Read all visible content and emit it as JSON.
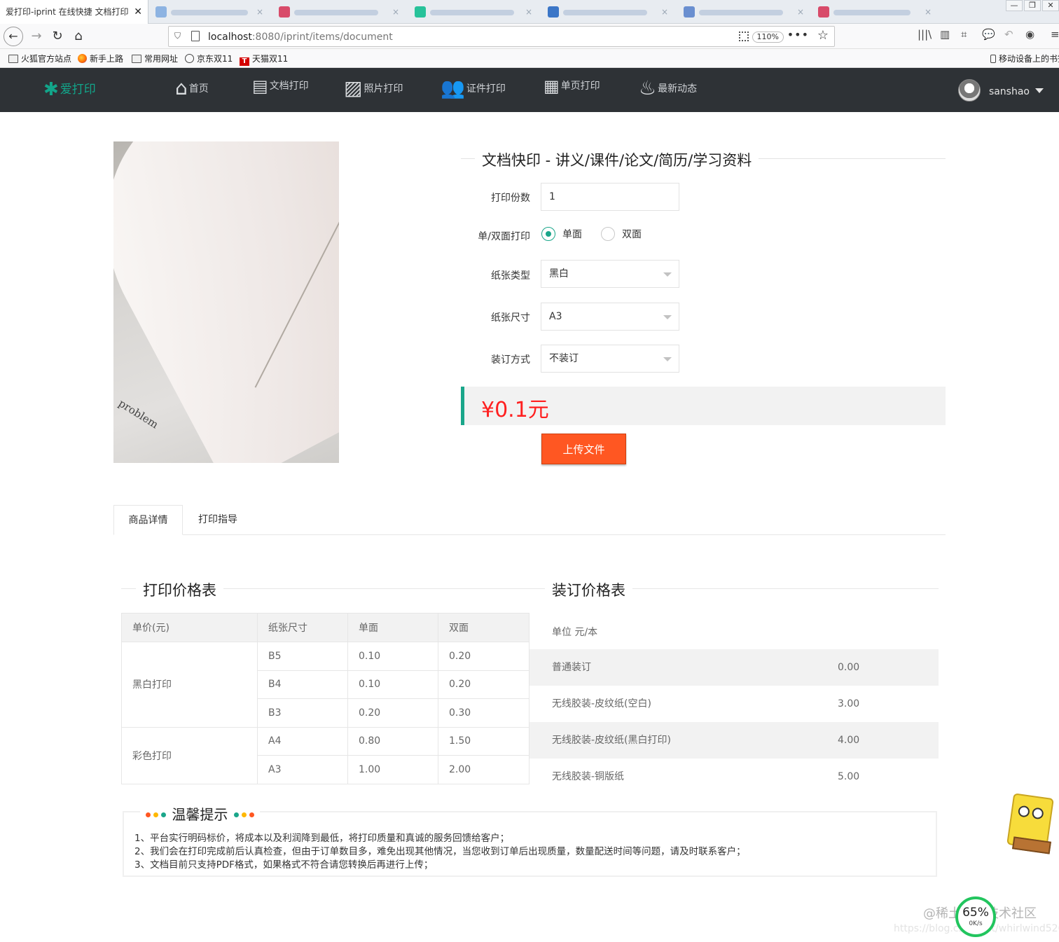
{
  "browser": {
    "active_tab_title": "爱打印-iprint 在线快捷 文档打印",
    "tab_close": "✕",
    "url_host": "localhost",
    "url_rest": ":8080/iprint/items/document",
    "zoom": "110%",
    "window_buttons": [
      "—",
      "❐",
      "✕"
    ],
    "bookmarks": [
      {
        "label": "火狐官方站点",
        "icon": "folder-icon"
      },
      {
        "label": "新手上路",
        "icon": "firefox-icon"
      },
      {
        "label": "常用网址",
        "icon": "folder-icon"
      },
      {
        "label": "京东双11",
        "icon": "globe-icon"
      },
      {
        "label": "天猫双11",
        "icon": "tmall-icon"
      }
    ],
    "mobile_bookmarks": "移动设备上的书签"
  },
  "site": {
    "logo_text": "爱打印",
    "nav": [
      {
        "label": "首页",
        "icon": "home-icon"
      },
      {
        "label": "文档打印",
        "icon": "document-icon"
      },
      {
        "label": "照片打印",
        "icon": "photo-icon"
      },
      {
        "label": "证件打印",
        "icon": "id-card-icon"
      },
      {
        "label": "单页打印",
        "icon": "page-icon"
      },
      {
        "label": "最新动态",
        "icon": "flame-icon"
      }
    ],
    "username": "sanshao"
  },
  "product": {
    "title": "文档快印 - 讲义/课件/论文/简历/学习资料",
    "image_text": "problem",
    "copies_label": "打印份数",
    "copies_value": "1",
    "duplex_label": "单/双面打印",
    "duplex_options": [
      "单面",
      "双面"
    ],
    "duplex_selected": "单面",
    "paper_type_label": "纸张类型",
    "paper_type_value": "黑白",
    "paper_size_label": "纸张尺寸",
    "paper_size_value": "A3",
    "binding_label": "装订方式",
    "binding_value": "不装订",
    "price": "¥0.1元",
    "upload_label": "上传文件"
  },
  "tabs": [
    "商品详情",
    "打印指导"
  ],
  "print_table": {
    "title": "打印价格表",
    "headers": [
      "单价(元)",
      "纸张尺寸",
      "单面",
      "双面"
    ],
    "groups": [
      {
        "name": "黑白打印",
        "rows": [
          [
            "B5",
            "0.10",
            "0.20"
          ],
          [
            "B4",
            "0.10",
            "0.20"
          ],
          [
            "B3",
            "0.20",
            "0.30"
          ]
        ]
      },
      {
        "name": "彩色打印",
        "rows": [
          [
            "A4",
            "0.80",
            "1.50"
          ],
          [
            "A3",
            "1.00",
            "2.00"
          ]
        ]
      }
    ]
  },
  "binding_table": {
    "title": "装订价格表",
    "unit": "单位 元/本",
    "rows": [
      {
        "name": "普通装订",
        "price": "0.00"
      },
      {
        "name": "无线胶装-皮纹纸(空白)",
        "price": "3.00"
      },
      {
        "name": "无线胶装-皮纹纸(黑白打印)",
        "price": "4.00"
      },
      {
        "name": "无线胶装-铜版纸",
        "price": "5.00"
      }
    ]
  },
  "tips": {
    "title": "温馨提示",
    "lines": [
      "1、平台实行明码标价，将成本以及利润降到最低，将打印质量和真诚的服务回馈给客户；",
      "2、我们会在打印完成前后认真检查，但由于订单数目多，难免出现其他情况，当您收到订单后出现质量，数量配送时间等问题，请及时联系客户；",
      "3、文档目前只支持PDF格式，如果格式不符合请您转换后再进行上传；"
    ]
  },
  "overlay": {
    "watermark": "@稀土掘金技术社区",
    "watermark_url": "https://blog.csdn.net/whirlwind526",
    "speed_percent": "65%",
    "speed_rate": "0K/s"
  },
  "colors": {
    "accent": "#1aa68a",
    "price": "#ff1f1f",
    "upload": "#ff5722",
    "header_bg": "#2e3236"
  }
}
